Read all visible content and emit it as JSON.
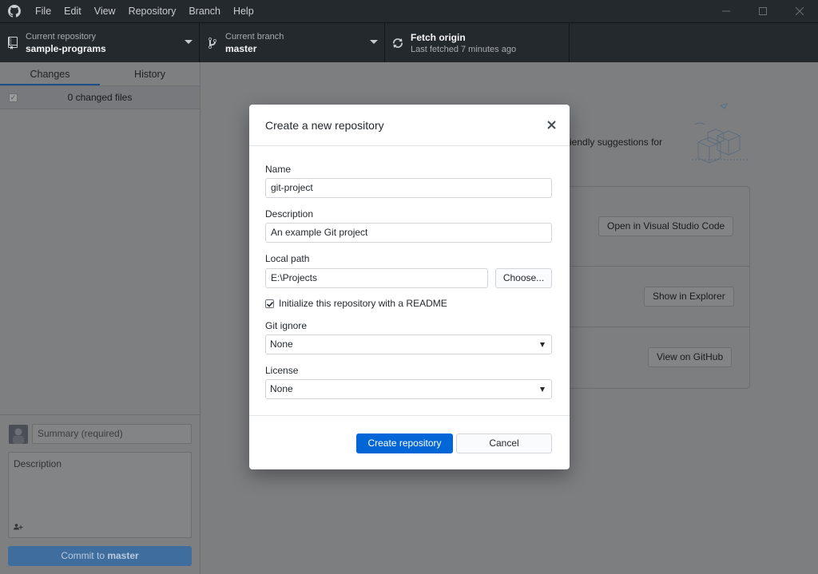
{
  "menu": [
    "File",
    "Edit",
    "View",
    "Repository",
    "Branch",
    "Help"
  ],
  "toolbar": {
    "repo": {
      "label": "Current repository",
      "value": "sample-programs"
    },
    "branch": {
      "label": "Current branch",
      "value": "master"
    },
    "fetch": {
      "title": "Fetch origin",
      "subtitle": "Last fetched 7 minutes ago"
    }
  },
  "sidebar": {
    "tabs": [
      "Changes",
      "History"
    ],
    "changed_files": "0 changed files",
    "summary_placeholder": "Summary (required)",
    "description_placeholder": "Description",
    "commit_prefix": "Commit to ",
    "commit_branch": "master"
  },
  "background": {
    "suggestion_fragment": "iendly suggestions for",
    "buttons": [
      "Open in Visual Studio Code",
      "Show in Explorer",
      "View on GitHub"
    ]
  },
  "dialog": {
    "title": "Create a new repository",
    "name_label": "Name",
    "name_value": "git-project",
    "description_label": "Description",
    "description_value": "An example Git project",
    "path_label": "Local path",
    "path_value": "E:\\Projects",
    "choose_label": "Choose...",
    "readme_label": "Initialize this repository with a README",
    "readme_checked": true,
    "gitignore_label": "Git ignore",
    "gitignore_value": "None",
    "license_label": "License",
    "license_value": "None",
    "create_label": "Create repository",
    "cancel_label": "Cancel"
  },
  "colors": {
    "titlebar": "#24292e",
    "primary": "#0366d6",
    "overlay": "#7d7e80"
  }
}
